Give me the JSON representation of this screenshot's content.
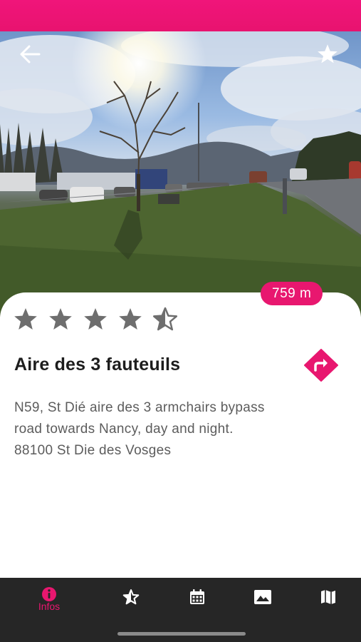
{
  "header": {
    "back_icon": "arrow-left-icon",
    "favorite_icon": "star-icon"
  },
  "place": {
    "distance": "759 m",
    "rating": 4.5,
    "rating_max": 5,
    "name": "Aire des 3 fauteuils",
    "description_lines": [
      "N59, St Dié aire des 3 armchairs bypass",
      "road towards Nancy, day and night.",
      "88100 St Die des Vosges"
    ],
    "directions_icon": "directions-icon"
  },
  "bottom_nav": {
    "items": [
      {
        "icon": "info-icon",
        "label": "Infos",
        "active": true
      },
      {
        "icon": "star-half-icon",
        "label": "",
        "active": false
      },
      {
        "icon": "calendar-icon",
        "label": "",
        "active": false
      },
      {
        "icon": "image-icon",
        "label": "",
        "active": false
      },
      {
        "icon": "map-icon",
        "label": "",
        "active": false
      }
    ]
  },
  "colors": {
    "accent": "#e8176f",
    "nav_background": "#262626",
    "star": "#6e6e6e",
    "title": "#1d1d1d",
    "body_text": "#5c5c5c"
  }
}
